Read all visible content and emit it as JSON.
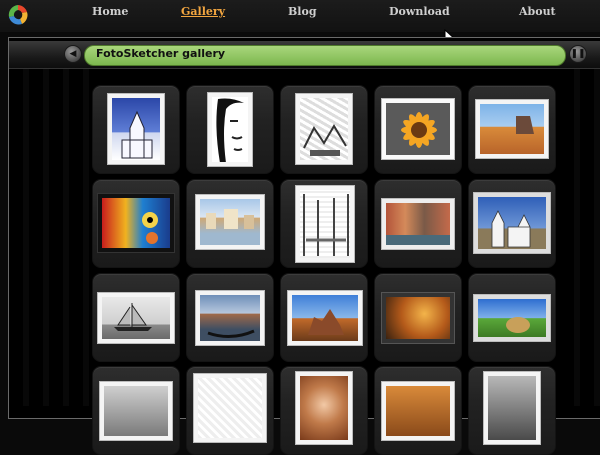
{
  "nav": {
    "items": [
      {
        "label": "Home",
        "active": false
      },
      {
        "label": "Gallery",
        "active": true
      },
      {
        "label": "Blog",
        "active": false
      },
      {
        "label": "Download",
        "active": false
      },
      {
        "label": "About",
        "active": false
      }
    ]
  },
  "gallery": {
    "title": "FotoSketcher gallery",
    "prev_icon": "arrow-left-icon",
    "next_icon": "pause-icon"
  },
  "colors": {
    "active_nav": "#f2a640",
    "title_pill": "#8fc45f",
    "background": "#000000"
  }
}
